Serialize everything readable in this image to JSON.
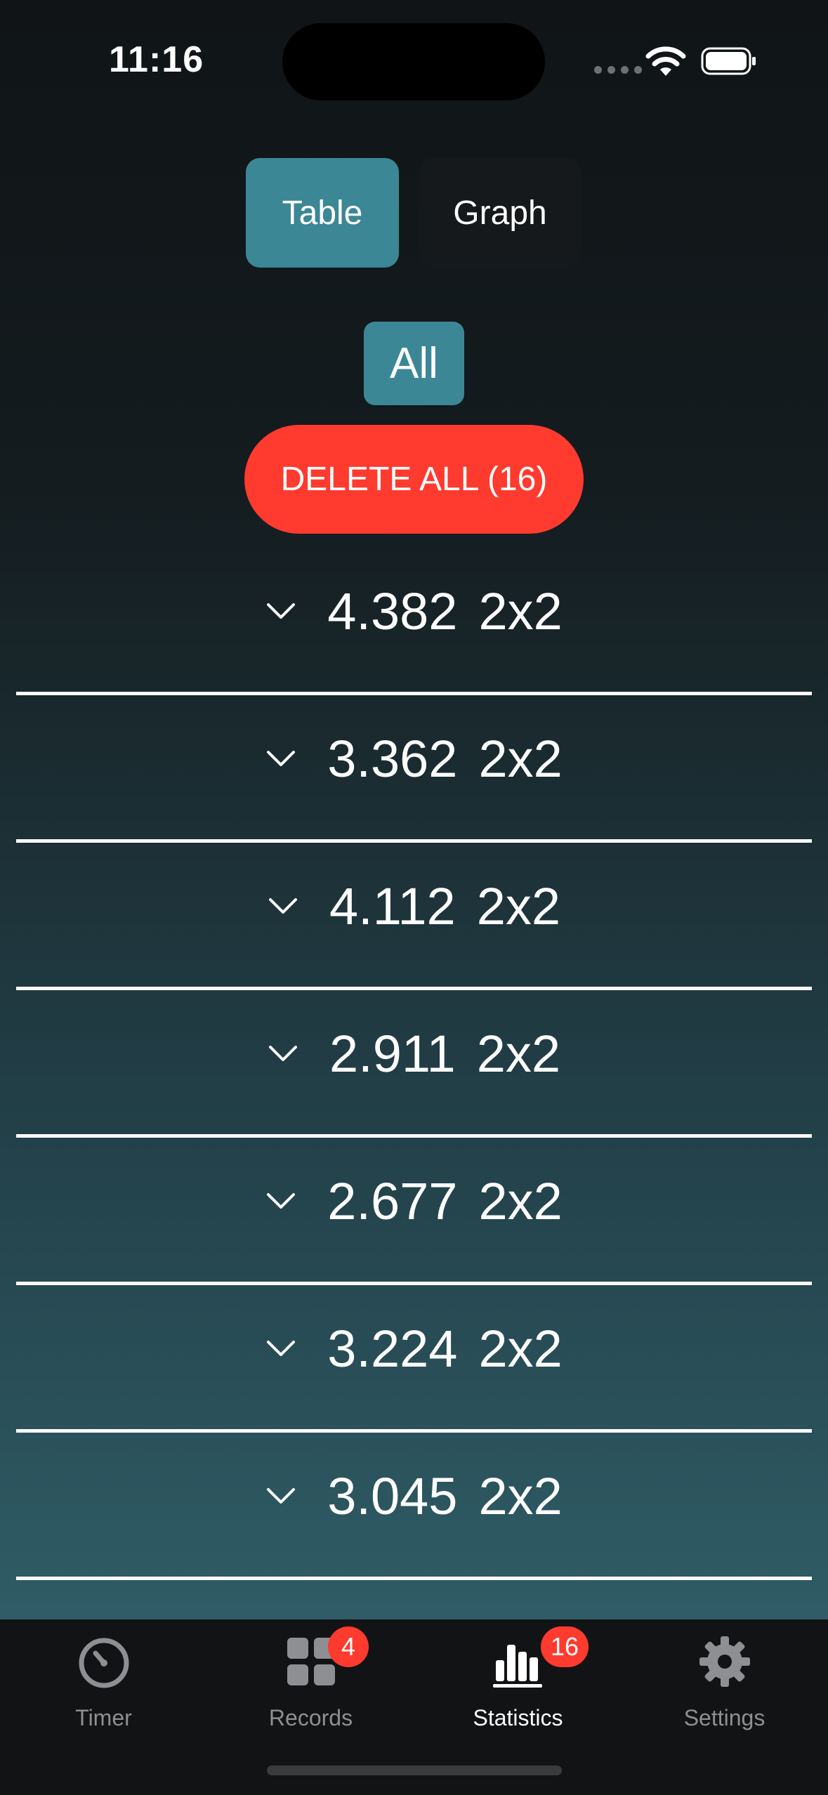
{
  "status_bar": {
    "time": "11:16"
  },
  "segmented": {
    "table_label": "Table",
    "graph_label": "Graph",
    "selected": "Table"
  },
  "filter": {
    "label": "All"
  },
  "delete_all": {
    "label": "DELETE ALL (16)"
  },
  "records": [
    {
      "time": "4.382",
      "puzzle": "2x2"
    },
    {
      "time": "3.362",
      "puzzle": "2x2"
    },
    {
      "time": "4.112",
      "puzzle": "2x2"
    },
    {
      "time": "2.911",
      "puzzle": "2x2"
    },
    {
      "time": "2.677",
      "puzzle": "2x2"
    },
    {
      "time": "3.224",
      "puzzle": "2x2"
    },
    {
      "time": "3.045",
      "puzzle": "2x2"
    }
  ],
  "tabbar": {
    "tabs": [
      {
        "label": "Timer",
        "icon": "timer-icon",
        "badge": ""
      },
      {
        "label": "Records",
        "icon": "grid-icon",
        "badge": "4"
      },
      {
        "label": "Statistics",
        "icon": "bar-chart-icon",
        "badge": "16"
      },
      {
        "label": "Settings",
        "icon": "gear-icon",
        "badge": ""
      }
    ],
    "active": "Statistics"
  },
  "colors": {
    "accent": "#3c8796",
    "danger": "#ff3a2f",
    "tabbar_bg": "#121315"
  }
}
